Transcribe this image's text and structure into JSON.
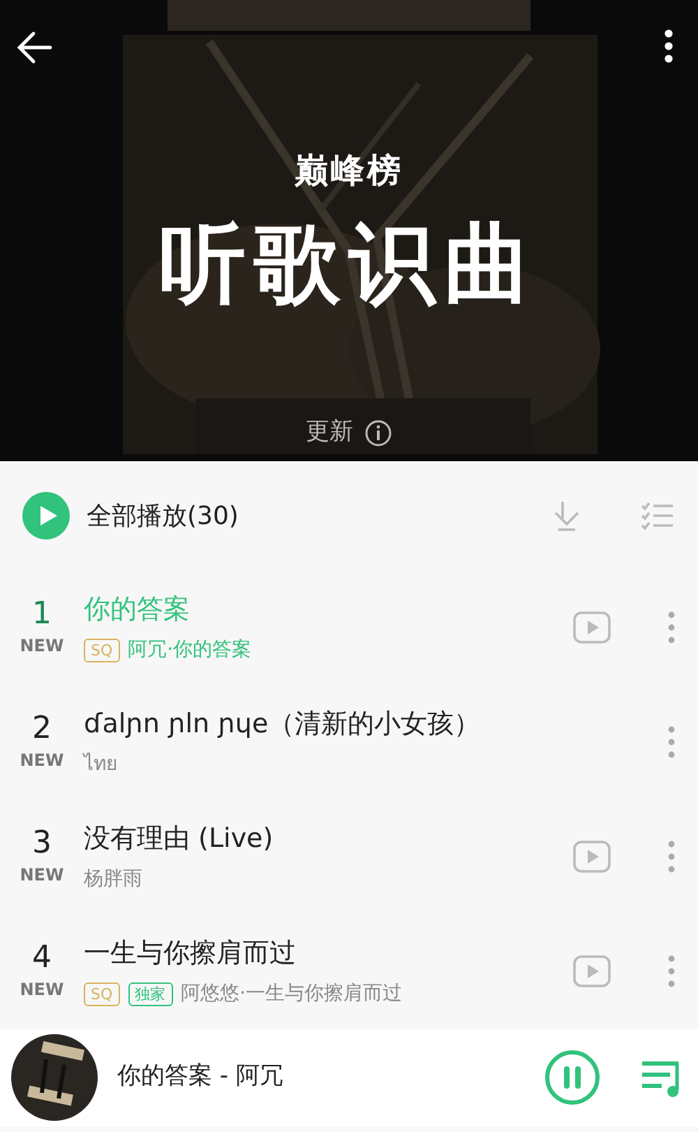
{
  "header": {
    "logo": "巅峰榜",
    "title": "听歌识曲",
    "update_note": "更新"
  },
  "play_all": {
    "label": "全部播放(30)"
  },
  "songs": [
    {
      "rank": "1",
      "badge": "NEW",
      "title": "你的答案",
      "tags": [
        {
          "text": "SQ",
          "kind": "quality"
        }
      ],
      "subtitle": "阿冗·你的答案",
      "selected": true,
      "video": true
    },
    {
      "rank": "2",
      "badge": "NEW",
      "title": "ɗalɲn ɲln ɲɥe（清新的小女孩）",
      "subtitle": "ไทย",
      "selected": false,
      "video": false
    },
    {
      "rank": "3",
      "badge": "NEW",
      "title": "没有理由 (Live)",
      "subtitle": "杨胖雨",
      "selected": false,
      "video": true
    },
    {
      "rank": "4",
      "badge": "NEW",
      "title": "一生与你擦肩而过",
      "tags": [
        {
          "text": "SQ",
          "kind": "quality"
        },
        {
          "text": "独家",
          "kind": "exclusive"
        }
      ],
      "subtitle": "阿悠悠·一生与你擦肩而过",
      "selected": false,
      "video": true
    }
  ],
  "player": {
    "now_playing": "你的答案 - 阿冗",
    "playing": true
  }
}
